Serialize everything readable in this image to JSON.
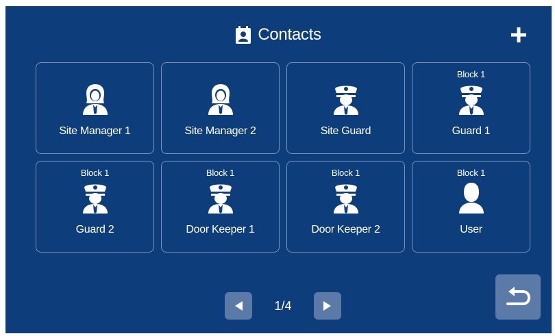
{
  "header": {
    "title": "Contacts",
    "title_icon": "contacts-book-icon",
    "add_icon": "plus-icon"
  },
  "contacts": [
    {
      "block": "",
      "name": "Site Manager 1",
      "icon": "female-person-icon"
    },
    {
      "block": "",
      "name": "Site Manager 2",
      "icon": "female-person-icon"
    },
    {
      "block": "",
      "name": "Site Guard",
      "icon": "guard-icon"
    },
    {
      "block": "Block 1",
      "name": "Guard 1",
      "icon": "guard-icon"
    },
    {
      "block": "Block 1",
      "name": "Guard 2",
      "icon": "guard-icon"
    },
    {
      "block": "Block 1",
      "name": "Door Keeper 1",
      "icon": "guard-icon"
    },
    {
      "block": "Block 1",
      "name": "Door Keeper 2",
      "icon": "guard-icon"
    },
    {
      "block": "Block 1",
      "name": "User",
      "icon": "person-icon"
    }
  ],
  "pager": {
    "page": "1/4",
    "prev_icon": "triangle-left-icon",
    "next_icon": "triangle-right-icon"
  },
  "back": {
    "icon": "return-arrow-icon"
  },
  "colors": {
    "background": "#0e3d7b",
    "button": "#5b7aa8",
    "text": "#ffffff"
  }
}
